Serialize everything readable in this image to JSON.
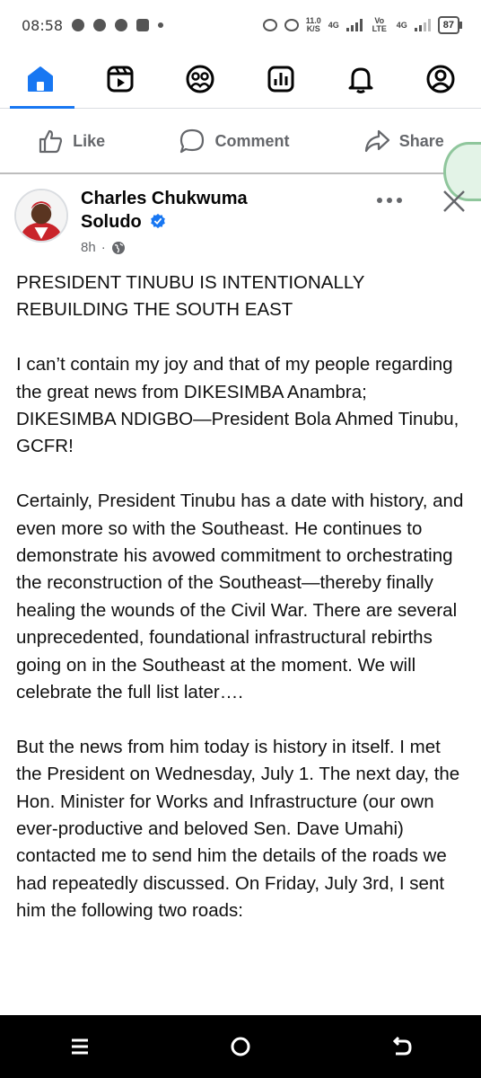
{
  "status_bar": {
    "time": "08:58",
    "net_speed": "11.0",
    "net_unit": "K/S",
    "net1": "4G",
    "volte": "Vo LTE",
    "net2": "4G",
    "battery": "87"
  },
  "nav": {
    "tabs": [
      "home-icon",
      "video-icon",
      "friends-icon",
      "dashboard-icon",
      "notifications-icon",
      "profile-icon"
    ],
    "active_color": "#1877f2"
  },
  "actions": {
    "like": "Like",
    "comment": "Comment",
    "share": "Share"
  },
  "post": {
    "author_line1": "Charles Chukwuma",
    "author_line2": "Soludo",
    "time": "8h",
    "dot": "·",
    "paragraphs": [
      "PRESIDENT TINUBU IS INTENTIONALLY REBUILDING THE SOUTH EAST",
      "I can’t contain my joy and that of my people regarding the great news from DIKESIMBA Anambra; DIKESIMBA NDIGBO—President Bola Ahmed Tinubu, GCFR!",
      "Certainly, President Tinubu has a date with history, and even more so with the Southeast. He continues to demonstrate his avowed commitment to orchestrating the reconstruction of the Southeast—thereby finally healing the wounds of the Civil War. There are several unprecedented, foundational infrastructural rebirths going on in the Southeast at the moment. We will celebrate the full list later….",
      "But the news from him today is history in itself. I met the President on Wednesday, July 1. The next day, the Hon. Minister for Works and Infrastructure (our own ever-productive and beloved Sen. Dave Umahi) contacted me to send him the details of the roads we had repeatedly discussed. On Friday, July 3rd, I sent him the following two roads:"
    ]
  },
  "colors": {
    "brand_blue": "#1877f2",
    "secondary_text": "#65676b"
  }
}
